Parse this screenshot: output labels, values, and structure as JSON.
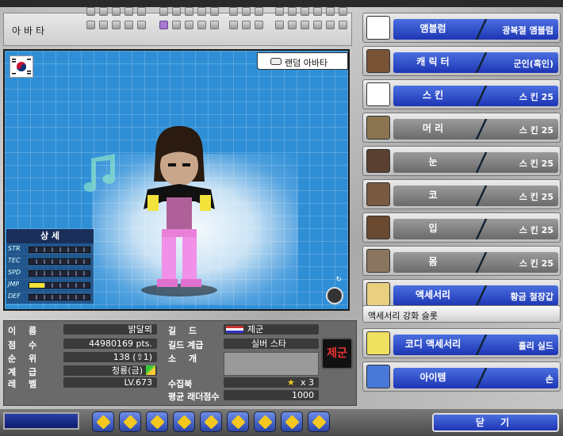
{
  "avatar_tabs": {
    "label": "아바타"
  },
  "stage": {
    "random_avatar_label": "랜덤 아바타"
  },
  "stats": {
    "title": "상 세",
    "rows": [
      {
        "key": "STR",
        "level": 0
      },
      {
        "key": "TEC",
        "level": 0
      },
      {
        "key": "SPD",
        "level": 0
      },
      {
        "key": "JMP",
        "level": 0.25
      },
      {
        "key": "DEF",
        "level": 0
      }
    ]
  },
  "info": {
    "name_label": "이 름",
    "name_value": "밝달뫼",
    "score_label": "점 수",
    "score_value": "44980169 pts.",
    "rank_label": "순 위",
    "rank_value": "138 (⇧1)",
    "grade_label": "계 급",
    "grade_value": "청룡(금)",
    "level_label": "레 벨",
    "level_value": "LV.673",
    "guild_label": "길 드",
    "guild_value": "제군",
    "guild_rank_label": "길드 계급",
    "guild_rank_value": "실버 스타",
    "intro_label": "소 개",
    "collection_label": "수집북",
    "collection_value": "x 3",
    "ladder_label": "평균 래더점수",
    "ladder_value": "1000",
    "guild_badge": "제군"
  },
  "right_panel": [
    {
      "name": "앰블럼",
      "value": "광복절 앰블럼",
      "style": "blue",
      "icon": "flag-icon"
    },
    {
      "name": "캐 릭 터",
      "value": "군인(흑인)",
      "style": "blue",
      "icon": "character-icon"
    },
    {
      "name": "스 킨",
      "value": "스 킨 25",
      "style": "blue",
      "icon": "skin-icon"
    },
    {
      "name": "머 리",
      "value": "스 킨 25",
      "style": "gray",
      "icon": "hair-icon"
    },
    {
      "name": "눈",
      "value": "스 킨 25",
      "style": "gray",
      "icon": "eye-icon"
    },
    {
      "name": "코",
      "value": "스 킨 25",
      "style": "gray",
      "icon": "nose-icon"
    },
    {
      "name": "입",
      "value": "스 킨 25",
      "style": "gray",
      "icon": "mouth-icon"
    },
    {
      "name": "몸",
      "value": "스 킨 25",
      "style": "gray",
      "icon": "body-icon"
    },
    {
      "name": "액세서리",
      "value": "황금 철장갑",
      "style": "blue",
      "icon": "glove-icon"
    },
    {
      "name": "코디 액세서리",
      "value": "홀리 실드",
      "style": "blue",
      "icon": "shield-icon"
    },
    {
      "name": "아이템",
      "value": "손",
      "style": "blue",
      "icon": "hand-icon"
    }
  ],
  "accessory_slot_label": "액세서리 강화 슬롯",
  "close_label": "닫 기"
}
